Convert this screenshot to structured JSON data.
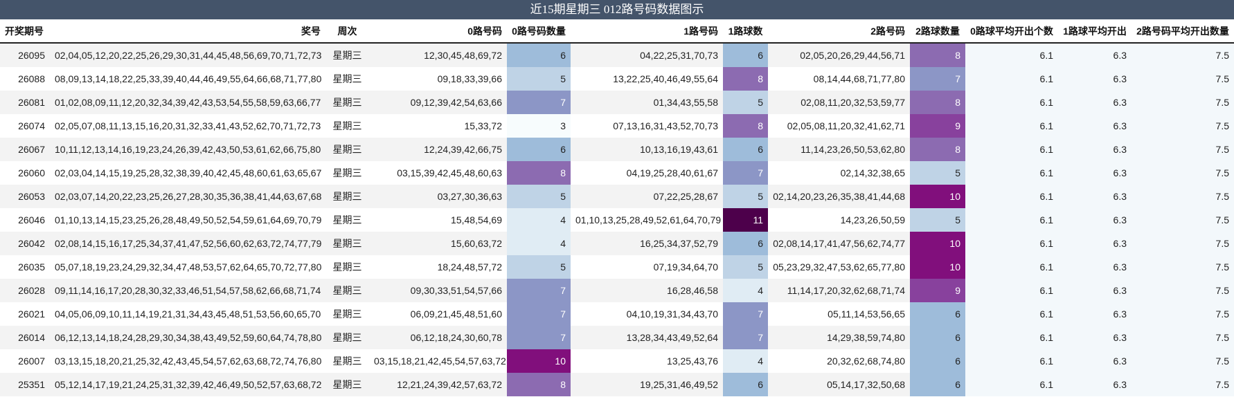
{
  "title": "近15期星期三 012路号码数据图示",
  "columns": [
    "开奖期号",
    "奖号",
    "周次",
    "0路号码",
    "0路号码数量",
    "1路号码",
    "1路球数",
    "2路号码",
    "2路球数量",
    "0路球平均开出个数",
    "1路球平均开出",
    "2路号码平均开出数量"
  ],
  "chart_data": {
    "type": "table",
    "title": "近15期星期三 012路号码数据图示",
    "colorscale": "BuPu",
    "count_range": [
      3,
      11
    ],
    "rows": [
      {
        "issue": "26095",
        "numbers": "02,04,05,12,20,22,25,26,29,30,31,44,45,48,56,69,70,71,72,73",
        "weekday": "星期三",
        "r0": "12,30,45,48,69,72",
        "c0": 6,
        "r1": "04,22,25,31,70,73",
        "c1": 6,
        "r2": "02,05,20,26,29,44,56,71",
        "c2": 8,
        "a0": "6.1",
        "a1": "6.3",
        "a2": "7.5"
      },
      {
        "issue": "26088",
        "numbers": "08,09,13,14,18,22,25,33,39,40,44,46,49,55,64,66,68,71,77,80",
        "weekday": "星期三",
        "r0": "09,18,33,39,66",
        "c0": 5,
        "r1": "13,22,25,40,46,49,55,64",
        "c1": 8,
        "r2": "08,14,44,68,71,77,80",
        "c2": 7,
        "a0": "6.1",
        "a1": "6.3",
        "a2": "7.5"
      },
      {
        "issue": "26081",
        "numbers": "01,02,08,09,11,12,20,32,34,39,42,43,53,54,55,58,59,63,66,77",
        "weekday": "星期三",
        "r0": "09,12,39,42,54,63,66",
        "c0": 7,
        "r1": "01,34,43,55,58",
        "c1": 5,
        "r2": "02,08,11,20,32,53,59,77",
        "c2": 8,
        "a0": "6.1",
        "a1": "6.3",
        "a2": "7.5"
      },
      {
        "issue": "26074",
        "numbers": "02,05,07,08,11,13,15,16,20,31,32,33,41,43,52,62,70,71,72,73",
        "weekday": "星期三",
        "r0": "15,33,72",
        "c0": 3,
        "r1": "07,13,16,31,43,52,70,73",
        "c1": 8,
        "r2": "02,05,08,11,20,32,41,62,71",
        "c2": 9,
        "a0": "6.1",
        "a1": "6.3",
        "a2": "7.5"
      },
      {
        "issue": "26067",
        "numbers": "10,11,12,13,14,16,19,23,24,26,39,42,43,50,53,61,62,66,75,80",
        "weekday": "星期三",
        "r0": "12,24,39,42,66,75",
        "c0": 6,
        "r1": "10,13,16,19,43,61",
        "c1": 6,
        "r2": "11,14,23,26,50,53,62,80",
        "c2": 8,
        "a0": "6.1",
        "a1": "6.3",
        "a2": "7.5"
      },
      {
        "issue": "26060",
        "numbers": "02,03,04,14,15,19,25,28,32,38,39,40,42,45,48,60,61,63,65,67",
        "weekday": "星期三",
        "r0": "03,15,39,42,45,48,60,63",
        "c0": 8,
        "r1": "04,19,25,28,40,61,67",
        "c1": 7,
        "r2": "02,14,32,38,65",
        "c2": 5,
        "a0": "6.1",
        "a1": "6.3",
        "a2": "7.5"
      },
      {
        "issue": "26053",
        "numbers": "02,03,07,14,20,22,23,25,26,27,28,30,35,36,38,41,44,63,67,68",
        "weekday": "星期三",
        "r0": "03,27,30,36,63",
        "c0": 5,
        "r1": "07,22,25,28,67",
        "c1": 5,
        "r2": "02,14,20,23,26,35,38,41,44,68",
        "c2": 10,
        "a0": "6.1",
        "a1": "6.3",
        "a2": "7.5"
      },
      {
        "issue": "26046",
        "numbers": "01,10,13,14,15,23,25,26,28,48,49,50,52,54,59,61,64,69,70,79",
        "weekday": "星期三",
        "r0": "15,48,54,69",
        "c0": 4,
        "r1": "01,10,13,25,28,49,52,61,64,70,79",
        "c1": 11,
        "r2": "14,23,26,50,59",
        "c2": 5,
        "a0": "6.1",
        "a1": "6.3",
        "a2": "7.5"
      },
      {
        "issue": "26042",
        "numbers": "02,08,14,15,16,17,25,34,37,41,47,52,56,60,62,63,72,74,77,79",
        "weekday": "星期三",
        "r0": "15,60,63,72",
        "c0": 4,
        "r1": "16,25,34,37,52,79",
        "c1": 6,
        "r2": "02,08,14,17,41,47,56,62,74,77",
        "c2": 10,
        "a0": "6.1",
        "a1": "6.3",
        "a2": "7.5"
      },
      {
        "issue": "26035",
        "numbers": "05,07,18,19,23,24,29,32,34,47,48,53,57,62,64,65,70,72,77,80",
        "weekday": "星期三",
        "r0": "18,24,48,57,72",
        "c0": 5,
        "r1": "07,19,34,64,70",
        "c1": 5,
        "r2": "05,23,29,32,47,53,62,65,77,80",
        "c2": 10,
        "a0": "6.1",
        "a1": "6.3",
        "a2": "7.5"
      },
      {
        "issue": "26028",
        "numbers": "09,11,14,16,17,20,28,30,32,33,46,51,54,57,58,62,66,68,71,74",
        "weekday": "星期三",
        "r0": "09,30,33,51,54,57,66",
        "c0": 7,
        "r1": "16,28,46,58",
        "c1": 4,
        "r2": "11,14,17,20,32,62,68,71,74",
        "c2": 9,
        "a0": "6.1",
        "a1": "6.3",
        "a2": "7.5"
      },
      {
        "issue": "26021",
        "numbers": "04,05,06,09,10,11,14,19,21,31,34,43,45,48,51,53,56,60,65,70",
        "weekday": "星期三",
        "r0": "06,09,21,45,48,51,60",
        "c0": 7,
        "r1": "04,10,19,31,34,43,70",
        "c1": 7,
        "r2": "05,11,14,53,56,65",
        "c2": 6,
        "a0": "6.1",
        "a1": "6.3",
        "a2": "7.5"
      },
      {
        "issue": "26014",
        "numbers": "06,12,13,14,18,24,28,29,30,34,38,43,49,52,59,60,64,74,78,80",
        "weekday": "星期三",
        "r0": "06,12,18,24,30,60,78",
        "c0": 7,
        "r1": "13,28,34,43,49,52,64",
        "c1": 7,
        "r2": "14,29,38,59,74,80",
        "c2": 6,
        "a0": "6.1",
        "a1": "6.3",
        "a2": "7.5"
      },
      {
        "issue": "26007",
        "numbers": "03,13,15,18,20,21,25,32,42,43,45,54,57,62,63,68,72,74,76,80",
        "weekday": "星期三",
        "r0": "03,15,18,21,42,45,54,57,63,72",
        "c0": 10,
        "r1": "13,25,43,76",
        "c1": 4,
        "r2": "20,32,62,68,74,80",
        "c2": 6,
        "a0": "6.1",
        "a1": "6.3",
        "a2": "7.5"
      },
      {
        "issue": "25351",
        "numbers": "05,12,14,17,19,21,24,25,31,32,39,42,46,49,50,52,57,63,68,72",
        "weekday": "星期三",
        "r0": "12,21,24,39,42,57,63,72",
        "c0": 8,
        "r1": "19,25,31,46,49,52",
        "c1": 6,
        "r2": "05,14,17,32,50,68",
        "c2": 6,
        "a0": "6.1",
        "a1": "6.3",
        "a2": "7.5"
      }
    ]
  }
}
